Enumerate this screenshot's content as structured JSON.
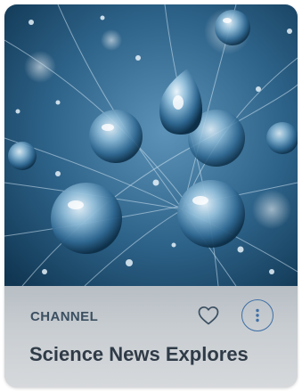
{
  "card": {
    "category": "CHANNEL",
    "title": "Science News Explores",
    "hero_image": "water-droplets-on-dandelion-seeds",
    "favorite_icon": "heart-outline-icon",
    "more_icon": "vertical-ellipsis-icon"
  },
  "colors": {
    "label": "#3b4f61",
    "title": "#2f3b47",
    "accent": "#3f6fa6",
    "hero_dark": "#0f3550",
    "hero_light": "#6fa3c6"
  }
}
